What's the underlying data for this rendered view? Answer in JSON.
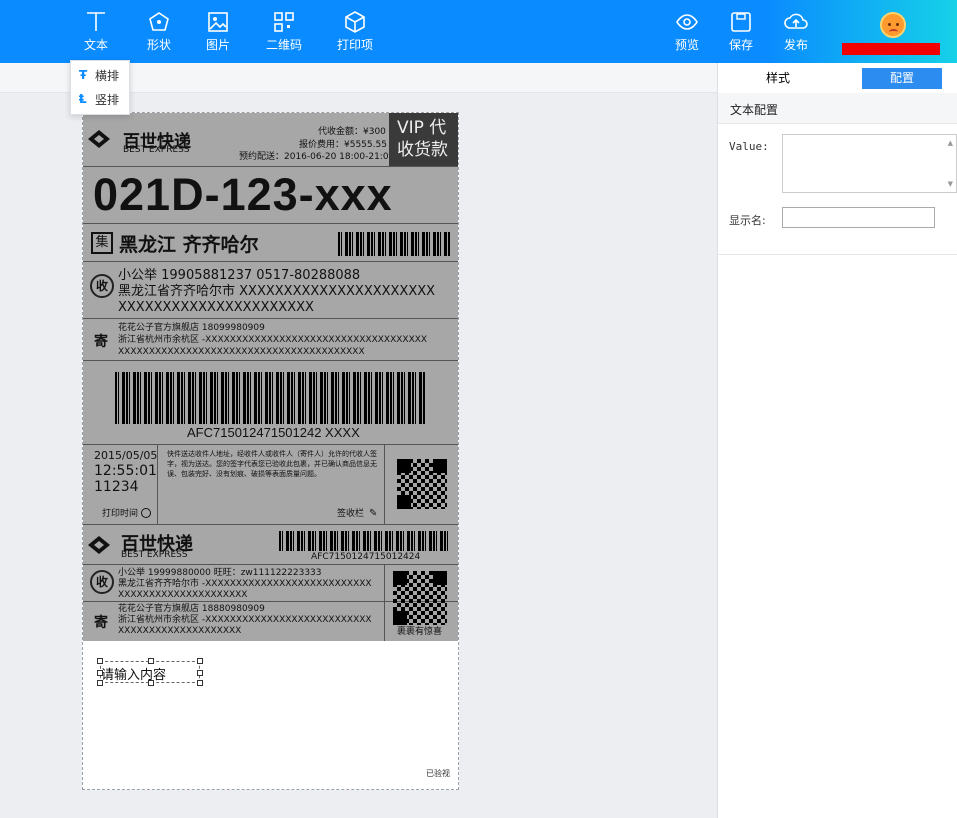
{
  "toolbar": {
    "tools": [
      {
        "label": "文本",
        "icon": "text-icon"
      },
      {
        "label": "形状",
        "icon": "shape-icon"
      },
      {
        "label": "图片",
        "icon": "image-icon"
      },
      {
        "label": "二维码",
        "icon": "qrcode-icon"
      },
      {
        "label": "打印项",
        "icon": "print-item-icon"
      }
    ],
    "actions": [
      {
        "label": "预览",
        "icon": "eye-icon"
      },
      {
        "label": "保存",
        "icon": "save-icon"
      },
      {
        "label": "发布",
        "icon": "cloud-upload-icon"
      }
    ]
  },
  "text_dropdown": {
    "items": [
      "横排",
      "竖排"
    ]
  },
  "label": {
    "brand_cn": "百世快递",
    "brand_en": "BEST EXPRESS",
    "cod_amount": "代收金额：¥300",
    "fee": "报价费用：¥5555.55",
    "appointment": "预约配送：2016-06-20 18:00-21:00",
    "vip_line1": "VIP 代",
    "vip_line2": "收货款",
    "sort_code": "021D-123-xxx",
    "collect_icon": "集",
    "destination": "黑龙江 齐齐哈尔",
    "receive_icon": "收",
    "receiver_line1": "小公举    19905881237    0517-80288088",
    "receiver_line2": "黑龙江省齐齐哈尔市 XXXXXXXXXXXXXXXXXXXXXX",
    "receiver_line3": "XXXXXXXXXXXXXXXXXXXXXX",
    "send_icon": "寄",
    "sender_line1": "花花公子官方旗舰店    18099980909",
    "sender_line2": "浙江省杭州市余杭区 -XXXXXXXXXXXXXXXXXXXXXXXXXXXXXXXXXXXX",
    "sender_line3": "XXXXXXXXXXXXXXXXXXXXXXXXXXXXXXXXXXXXXXXX",
    "tracking": "AFC715012471501242 XXXX",
    "print_date": "2015/05/05",
    "print_time": "12:55:01",
    "print_num": "11234",
    "notice": "快件送达收件人地址，经收件人或收件人（寄件人）允许的代收人签字，视为送达。您的签字代表您已验收此包裹，并已确认商品信息无误、包装完好、没有划痕、破损等表面质量问题。",
    "print_time_label": "打印时间",
    "sign_label": "签收栏",
    "tracking2": "AFC7150124715012424",
    "receiver2_line1": "小公举    19999880000    旺旺：zw111122223333",
    "receiver2_line2": "黑龙江省齐齐哈尔市 -XXXXXXXXXXXXXXXXXXXXXXXXXXX",
    "receiver2_line3": "XXXXXXXXXXXXXXXXXXXXX",
    "sender2_line1": "花花公子官方旗舰店    18880980909",
    "sender2_line2": "浙江省杭州市余杭区 -XXXXXXXXXXXXXXXXXXXXXXXXXXX",
    "sender2_line3": "XXXXXXXXXXXXXXXXXXXX",
    "surprise": "裹裹有惊喜"
  },
  "canvas": {
    "textbox_placeholder": "请输入内容",
    "verified": "已验视"
  },
  "panel": {
    "tabs": [
      "样式",
      "配置"
    ],
    "active_tab": "配置",
    "section_title": "文本配置",
    "value_label": "Value:",
    "value": "",
    "display_name_label": "显示名:",
    "display_name": ""
  },
  "colors": {
    "toolbar_start": "#0a8bff",
    "toolbar_end": "#16d1e8",
    "active_tab": "#2d8cf0"
  }
}
